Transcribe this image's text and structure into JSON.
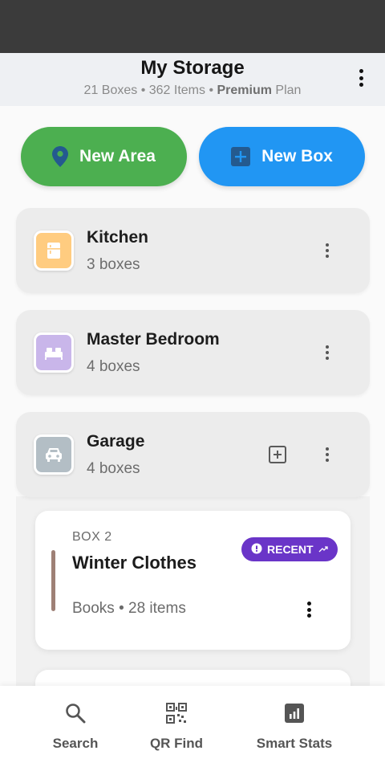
{
  "header": {
    "title": "My Storage",
    "subtitle_prefix": "21 Boxes • 362 Items • ",
    "subtitle_plan": "Premium",
    "subtitle_suffix": " Plan"
  },
  "actions": {
    "new_area": "New Area",
    "new_box": "New Box"
  },
  "areas": [
    {
      "name": "Kitchen",
      "count": "3 boxes",
      "color": "#ffcc80",
      "icon": "fridge-icon"
    },
    {
      "name": "Master Bedroom",
      "count": "4 boxes",
      "color": "#c9b6ea",
      "icon": "bed-icon"
    },
    {
      "name": "Garage",
      "count": "4 boxes",
      "color": "#b3bec5",
      "icon": "car-icon"
    }
  ],
  "box": {
    "label": "BOX 2",
    "name": "Winter Clothes",
    "meta": "Books • 28 items",
    "badge": "RECENT",
    "accent": "#9e8076"
  },
  "nav": [
    {
      "label": "Search",
      "icon": "search-icon"
    },
    {
      "label": "QR Find",
      "icon": "qr-code-icon"
    },
    {
      "label": "Smart Stats",
      "icon": "bar-chart-icon"
    }
  ],
  "colors": {
    "green": "#4caf50",
    "blue": "#2196f3",
    "badge_purple": "#6a35c8"
  }
}
